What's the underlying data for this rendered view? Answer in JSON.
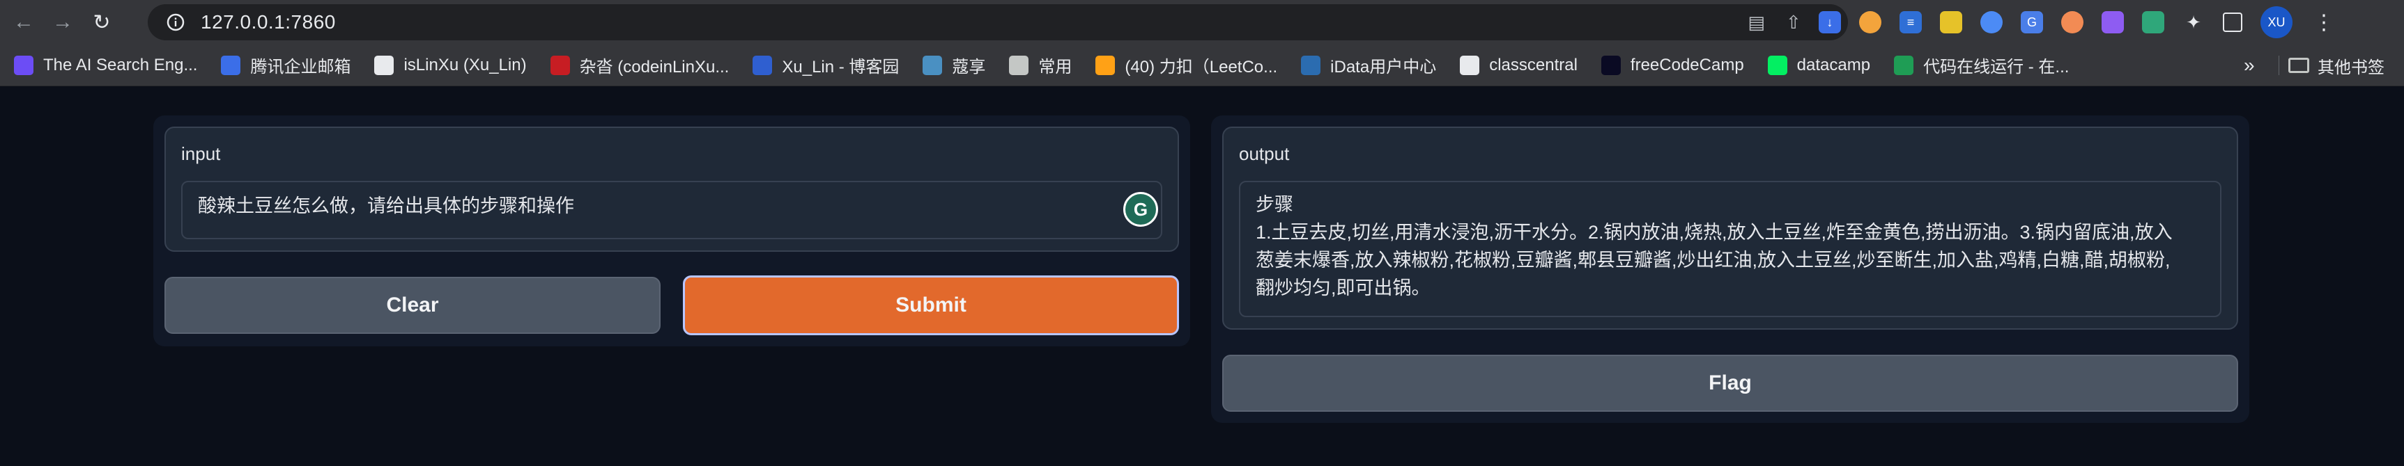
{
  "browser": {
    "url": "127.0.0.1:7860",
    "avatar_initials": "XU",
    "bookmarks": [
      {
        "label": "The AI Search Eng...",
        "icon": "ai-search-icon",
        "color": "#6c4df5"
      },
      {
        "label": "腾讯企业邮箱",
        "icon": "tencent-mail-icon",
        "color": "#3b6ee8"
      },
      {
        "label": "isLinXu (Xu_Lin)",
        "icon": "github-icon",
        "color": "#e8eaed"
      },
      {
        "label": "杂沓 (codeinLinXu...",
        "icon": "gitee-icon",
        "color": "#c71d23"
      },
      {
        "label": "Xu_Lin - 博客园",
        "icon": "cnblogs-icon",
        "color": "#2f5fd0"
      },
      {
        "label": "蔻享",
        "icon": "koushare-icon",
        "color": "#4a90c2"
      },
      {
        "label": "常用",
        "icon": "folder-icon",
        "color": "#c4c7c5"
      },
      {
        "label": "(40) 力扣（LeetCo...",
        "icon": "leetcode-icon",
        "color": "#ffa116"
      },
      {
        "label": "iData用户中心",
        "icon": "idata-icon",
        "color": "#2b6cb0"
      },
      {
        "label": "classcentral",
        "icon": "classcentral-icon",
        "color": "#e8eaed"
      },
      {
        "label": "freeCodeCamp",
        "icon": "freecodecamp-icon",
        "color": "#0a0a23"
      },
      {
        "label": "datacamp",
        "icon": "datacamp-icon",
        "color": "#03ef62"
      },
      {
        "label": "代码在线运行 - 在...",
        "icon": "code-runner-icon",
        "color": "#1f9d55"
      }
    ],
    "other_bookmarks": "其他书签",
    "more_bookmarks": "»"
  },
  "app": {
    "input_label": "input",
    "input_value": "酸辣土豆丝怎么做，请给出具体的步骤和操作",
    "clear_label": "Clear",
    "submit_label": "Submit",
    "output_label": "output",
    "output_heading": "步骤",
    "output_line1": "1.土豆去皮,切丝,用清水浸泡,沥干水分。2.锅内放油,烧热,放入土豆丝,炸至金黄色,捞出沥油。3.锅内留底油,放入",
    "output_line2": "葱姜末爆香,放入辣椒粉,花椒粉,豆瓣酱,郫县豆瓣酱,炒出红油,放入土豆丝,炒至断生,加入盐,鸡精,白糖,醋,胡椒粉,",
    "output_line3": "翻炒均匀,即可出锅。",
    "flag_label": "Flag",
    "grammarly_letter": "G"
  },
  "colors": {
    "page_bg": "#0b0f19",
    "panel_bg": "#111827",
    "submit_orange": "#e2692c",
    "button_gray": "#4b5563"
  }
}
